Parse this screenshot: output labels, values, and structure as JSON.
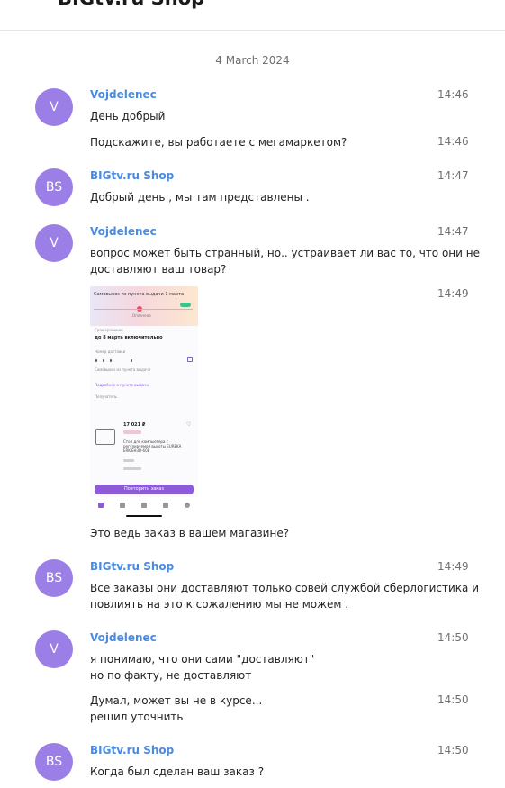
{
  "header": {
    "title": "BIGtv.ru Shop"
  },
  "date_separator": "4 March 2024",
  "avatars": {
    "v": "V",
    "bs": "BS"
  },
  "messages": [
    {
      "author": "Vojdelenec",
      "time": "14:46",
      "text": "День добрый"
    },
    {
      "time": "14:46",
      "text": "Подскажите, вы работаете с мегамаркетом?"
    },
    {
      "author": "BIGtv.ru Shop",
      "time": "14:47",
      "text": "Добрый день , мы там представлены ."
    },
    {
      "author": "Vojdelenec",
      "time": "14:47",
      "text_line1": "вопрос может быть странный, но.. устраивает ли вас то, что они не",
      "text_line2": "доставляют ваш товар?"
    },
    {
      "time": "14:49",
      "text": "Это ведь заказ в вашем магазине?"
    },
    {
      "author": "BIGtv.ru Shop",
      "time": "14:49",
      "text_line1": "Все заказы они доставляют только совей службой сберлогистика и",
      "text_line2": "повлиять на это к сожалению мы не можем ."
    },
    {
      "author": "Vojdelenec",
      "time": "14:50",
      "text_line1": "я понимаю, что они сами \"доставляют\"",
      "text_line2": "но по факту, не доставляют"
    },
    {
      "time": "14:50",
      "text_line1": "Думал, может вы не в курсе...",
      "text_line2": "решил уточнить"
    },
    {
      "author": "BIGtv.ru Shop",
      "time": "14:50",
      "text": "Когда был сделан ваш заказ ?"
    }
  ],
  "attachment": {
    "top_text": "Самовывоз из пункта выдачи 1 марта",
    "status_label": "Оплачено",
    "period_label": "Срок хранения",
    "period_value": "до 8 марта включительно",
    "code_label": "Номер доставки",
    "pickup_text": "Самовывоз из пункта выдачи",
    "details_link": "Подробнее о пункте выдачи",
    "recipient_label": "Получатель",
    "price": "17 021 ₽",
    "price_badge": "Оплачено",
    "product_desc": "Стол для компьютера с регулируемой высоты EUREKA ERK-EH3D-60B",
    "repeat_button": "Повторить заказ"
  }
}
